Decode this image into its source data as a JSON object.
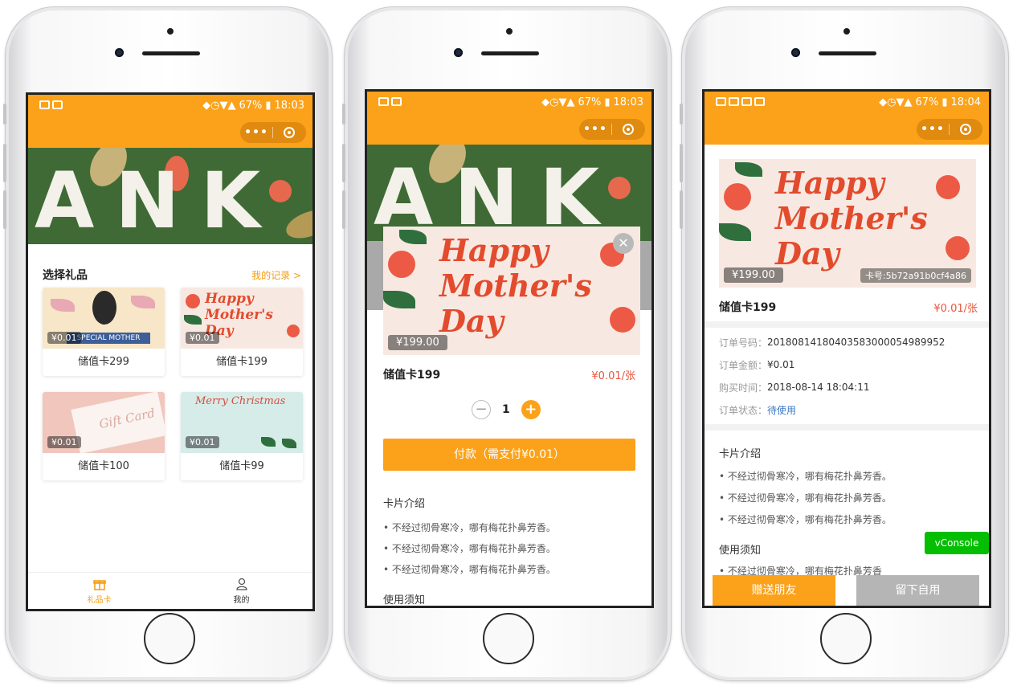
{
  "status_bars": [
    {
      "battery": "67%",
      "time": "18:03"
    },
    {
      "battery": "67%",
      "time": "18:03"
    },
    {
      "battery": "67%",
      "time": "18:04"
    }
  ],
  "capsule": {
    "more_icon": "more-dots-icon",
    "close_icon": "target-circle-icon"
  },
  "screen1": {
    "banner_text": "ANK",
    "section_title": "选择礼品",
    "records_link": "我的记录 >",
    "gifts": [
      {
        "name": "储值卡299",
        "price": "¥0.01",
        "art": "SPECIAL MOTHER"
      },
      {
        "name": "储值卡199",
        "price": "¥0.01",
        "art": "Happy Mother's Day"
      },
      {
        "name": "储值卡100",
        "price": "¥0.01",
        "art": "Gift Card"
      },
      {
        "name": "储值卡99",
        "price": "¥0.01",
        "art": "Merry Christmas"
      }
    ],
    "tabs": [
      {
        "label": "礼品卡",
        "icon": "gift-icon",
        "active": true
      },
      {
        "label": "我的",
        "icon": "user-icon",
        "active": false
      }
    ]
  },
  "screen2": {
    "banner_text": "ANK",
    "card_price": "¥199.00",
    "card_art": "Happy Mother's Day",
    "product_name": "储值卡199",
    "unit_price": "¥0.01/张",
    "quantity": "1",
    "pay_button": "付款（需支付¥0.01）",
    "intro_title": "卡片介绍",
    "intro_bullets": [
      "• 不经过彻骨寒冷，哪有梅花扑鼻芳香。",
      "• 不经过彻骨寒冷，哪有梅花扑鼻芳香。",
      "• 不经过彻骨寒冷，哪有梅花扑鼻芳香。"
    ],
    "notice_title": "使用须知"
  },
  "screen3": {
    "card_price": "¥199.00",
    "card_no": "卡号:5b72a91b0cf4a86",
    "card_art": "Happy Mother's Day",
    "product_name": "储值卡199",
    "unit_price": "¥0.01/张",
    "order": [
      {
        "key": "订单号码：",
        "value": "20180814180403583000054989952"
      },
      {
        "key": "订单金额：",
        "value": "¥0.01"
      },
      {
        "key": "购买时间：",
        "value": "2018-08-14 18:04:11"
      },
      {
        "key": "订单状态：",
        "value": "待使用"
      }
    ],
    "intro_title": "卡片介绍",
    "intro_bullets": [
      "• 不经过彻骨寒冷，哪有梅花扑鼻芳香。",
      "• 不经过彻骨寒冷，哪有梅花扑鼻芳香。",
      "• 不经过彻骨寒冷，哪有梅花扑鼻芳香。"
    ],
    "notice_title": "使用须知",
    "notice_bullet_partial": "• 不经过彻骨寒冷，哪有梅花扑鼻芳香",
    "vconsole": "vConsole",
    "send_friend": "赠送朋友",
    "keep_self": "留下自用"
  },
  "colors": {
    "accent": "#fba21a",
    "price_red": "#e8553e",
    "link_blue": "#3a78c3",
    "vconsole_green": "#04be02"
  }
}
